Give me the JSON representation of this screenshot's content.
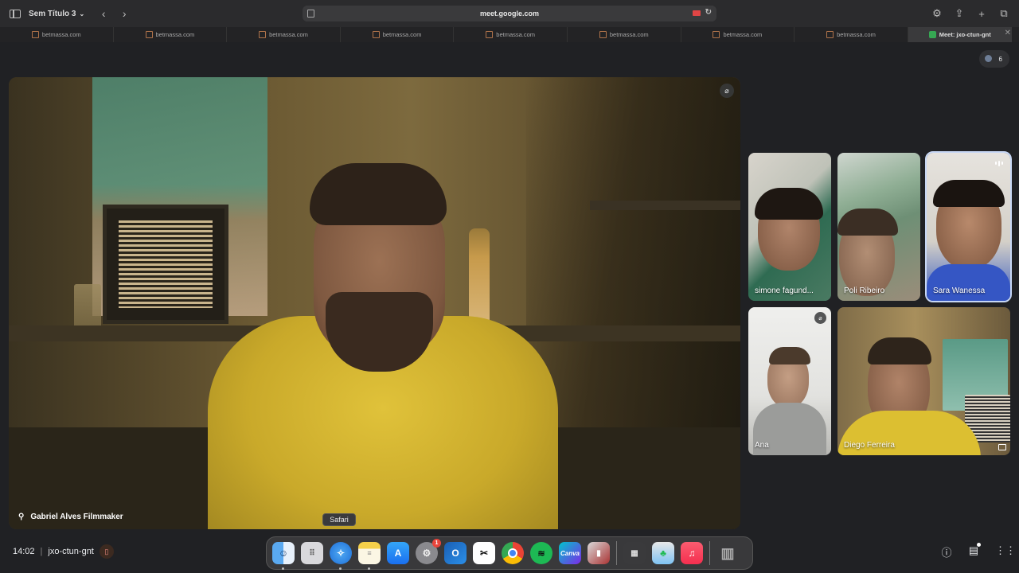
{
  "browser": {
    "tab_group": "Sem Título 3",
    "url": "meet.google.com"
  },
  "tabs": [
    {
      "label": "betmassa.com"
    },
    {
      "label": "betmassa.com"
    },
    {
      "label": "betmassa.com"
    },
    {
      "label": "betmassa.com"
    },
    {
      "label": "betmassa.com"
    },
    {
      "label": "betmassa.com"
    },
    {
      "label": "betmassa.com"
    },
    {
      "label": "betmassa.com"
    },
    {
      "label": "Meet: jxo-ctun-gnt",
      "active": true
    }
  ],
  "meet": {
    "participants_count": "6",
    "main_speaker": "Gabriel Alves Filmmaker",
    "participants": [
      {
        "name": "simone fagund...",
        "muted": false
      },
      {
        "name": "Poli Ribeiro",
        "muted": false
      },
      {
        "name": "Sara Wanessa",
        "speaking": true
      },
      {
        "name": "Ana",
        "muted": true
      },
      {
        "name": "Diego Ferreira",
        "muted": false
      }
    ],
    "time": "14:02",
    "meeting_code": "jxo-ctun-gnt"
  },
  "dock": {
    "tooltip": "Safari",
    "apps": [
      "Finder",
      "Launchpad",
      "Safari",
      "Notes",
      "App Store",
      "System Settings",
      "Outlook",
      "CapCut",
      "Chrome",
      "Spotify",
      "Canva",
      "Photo Booth",
      "Calculator",
      "Preview",
      "Music",
      "Trash"
    ],
    "badge_count": "1"
  },
  "colors": {
    "meet_bg": "#202124",
    "shirt_yellow": "#d9bb33",
    "active_outline": "#c7d7f5"
  }
}
